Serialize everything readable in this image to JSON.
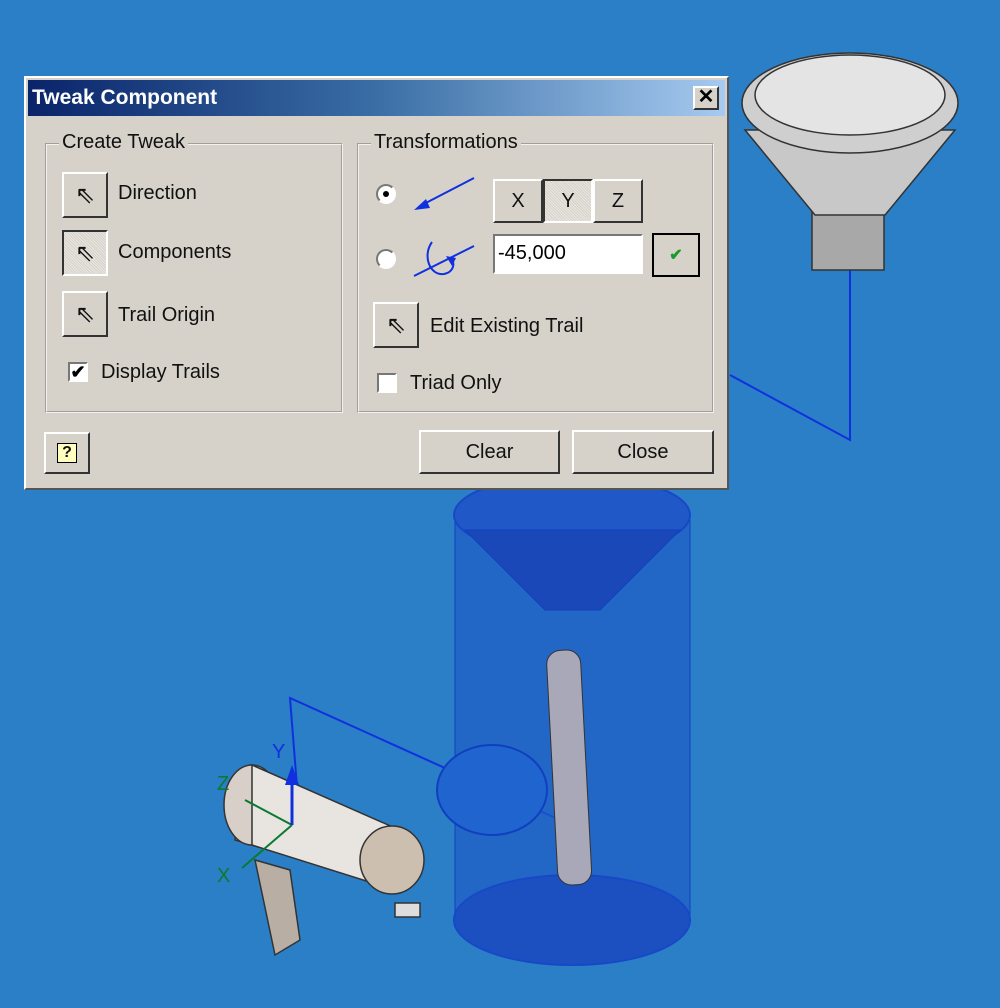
{
  "dialog": {
    "title": "Tweak Component",
    "close_label": "✕",
    "create_tweak": {
      "legend": "Create Tweak",
      "direction_label": "Direction",
      "components_label": "Components",
      "trail_origin_label": "Trail Origin",
      "display_trails_label": "Display Trails",
      "display_trails_checked": true
    },
    "transformations": {
      "legend": "Transformations",
      "mode_selected": "translate",
      "axes": [
        "X",
        "Y",
        "Z"
      ],
      "selected_axis": "Y",
      "value": "-45,000",
      "edit_trail_label": "Edit Existing Trail",
      "triad_only_label": "Triad Only",
      "triad_only_checked": false
    },
    "help_label": "?",
    "clear_label": "Clear",
    "close_button_label": "Close"
  },
  "scene": {
    "background": "#2a7fc6",
    "triad_labels": {
      "x": "X",
      "y": "Y",
      "z": "Z"
    }
  }
}
